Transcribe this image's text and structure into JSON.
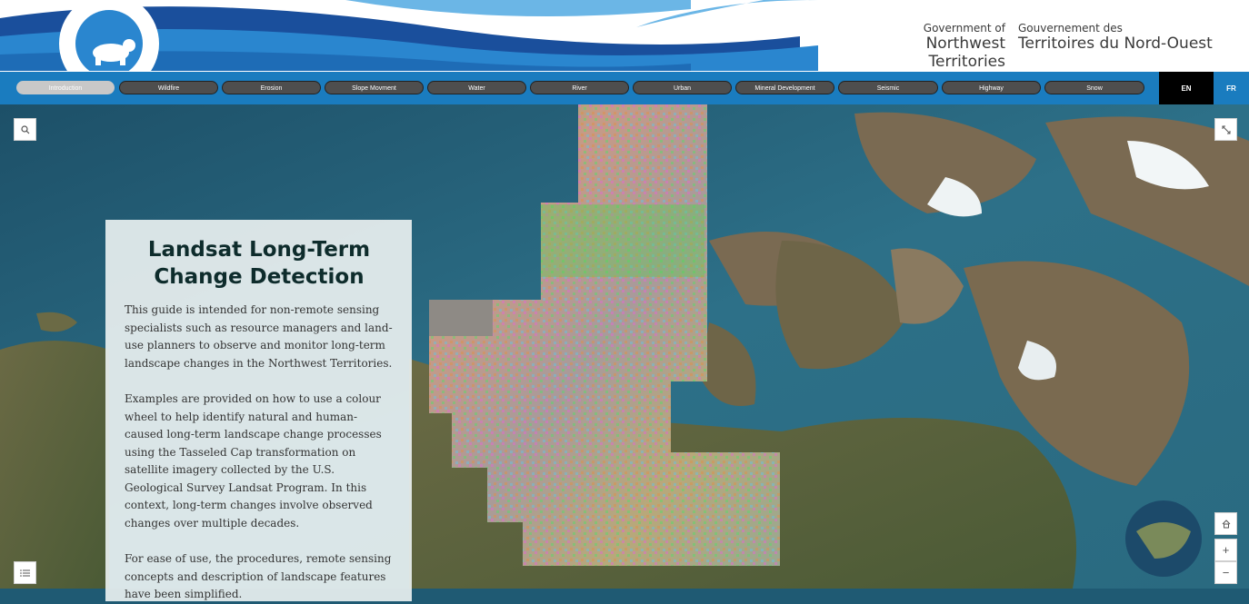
{
  "header": {
    "gov_en_small": "Government of",
    "gov_en_big": "Northwest Territories",
    "gov_fr_small": "Gouvernement des",
    "gov_fr_big": "Territoires du Nord-Ouest",
    "logo_icon": "polar-bear-icon"
  },
  "nav": {
    "tabs": [
      {
        "label": "Introduction"
      },
      {
        "label": "Wildfire"
      },
      {
        "label": "Erosion"
      },
      {
        "label": "Slope Movment"
      },
      {
        "label": "Water"
      },
      {
        "label": "River"
      },
      {
        "label": "Urban"
      },
      {
        "label": "Mineral Development"
      },
      {
        "label": "Seismic"
      },
      {
        "label": "Highway"
      },
      {
        "label": "Snow"
      }
    ],
    "active_tab": "Introduction",
    "lang_en": "EN",
    "lang_fr": "FR"
  },
  "panel": {
    "title": "Landsat Long-Term Change Detection",
    "paragraphs": [
      "This guide is intended for non-remote sensing specialists such as resource managers and land-use planners to observe and monitor long-term landscape changes in the Northwest Territories.",
      "Examples are provided on how to use a colour wheel to help identify natural and human-caused long-term landscape change processes using the Tasseled Cap transformation on satellite imagery collected by the U.S. Geological Survey Landsat Program. In this context, long-term changes involve observed changes over multiple decades.",
      "For ease of use, the procedures, remote sensing concepts and description of landscape features have been simplified."
    ]
  },
  "controls": {
    "search_icon": "search-icon",
    "expand_icon": "expand-icon",
    "legend_icon": "list-icon",
    "home_icon": "home-icon",
    "zoom_in": "+",
    "zoom_out": "−"
  },
  "colors": {
    "nav_bg": "#1a7cbf",
    "tab_bg": "#4e4e4e",
    "tab_active": "#c8c8c8",
    "ocean": "#2d6f86",
    "land": "#6f6a4a"
  }
}
